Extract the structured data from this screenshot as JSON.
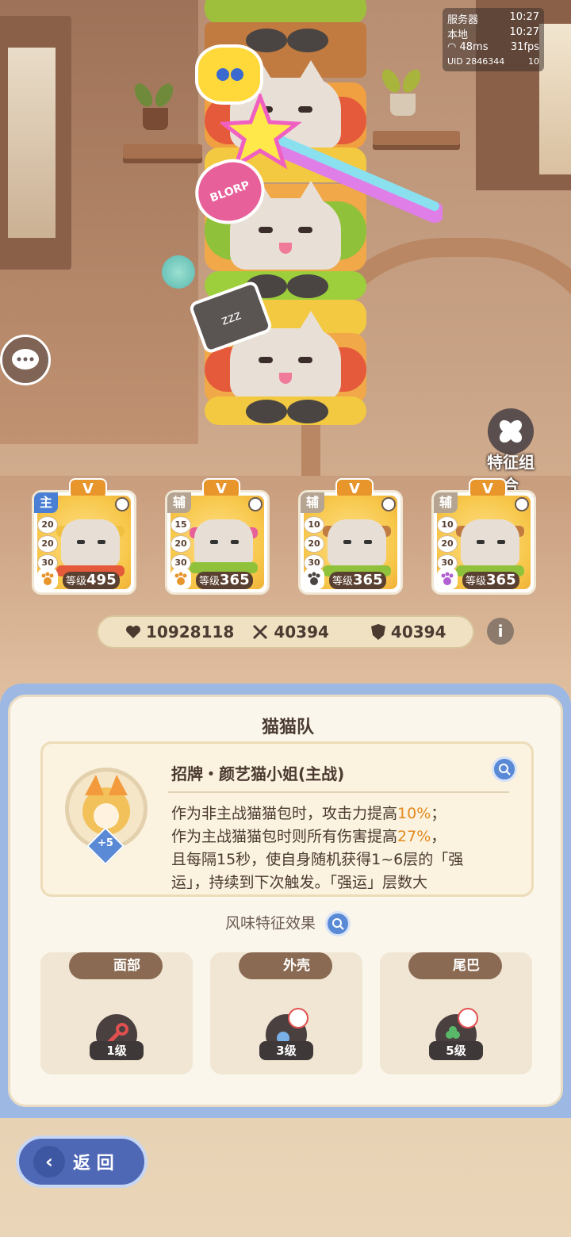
{
  "status": {
    "server_label": "服务器",
    "server_time": "10:27",
    "local_label": "本地",
    "local_time": "10:27",
    "ping": "48ms",
    "fps": "31fps",
    "uid": "UID 2846344",
    "badge": "10"
  },
  "trait_combo_label": "特征组合",
  "cards": [
    {
      "role": "主",
      "vip": "V",
      "nums": [
        "20",
        "20",
        "30"
      ],
      "level_label": "等级",
      "level": "495"
    },
    {
      "role": "辅",
      "vip": "V",
      "nums": [
        "15",
        "20",
        "30"
      ],
      "level_label": "等级",
      "level": "365"
    },
    {
      "role": "辅",
      "vip": "V",
      "nums": [
        "10",
        "20",
        "30"
      ],
      "level_label": "等级",
      "level": "365"
    },
    {
      "role": "辅",
      "vip": "V",
      "nums": [
        "10",
        "20",
        "30"
      ],
      "level_label": "等级",
      "level": "365"
    }
  ],
  "stats": {
    "hp": "10928118",
    "attack": "40394",
    "defense": "40394"
  },
  "panel": {
    "title": "猫猫队",
    "skill_name": "招牌・颜艺猫小姐(主战)",
    "avatar_badge": "+5",
    "desc_lines": [
      {
        "pre": "作为非主战猫猫包时，攻击力提高",
        "hl": "10%",
        "post": "；"
      },
      {
        "pre": "作为主战猫猫包时则所有伤害提高",
        "hl": "27%",
        "post": "，"
      },
      {
        "pre": "且每隔15秒，使自身随机获得1~6层的「强",
        "hl": "",
        "post": ""
      },
      {
        "pre": "运」，持续到下次触发。「强运」层数大",
        "hl": "",
        "post": ""
      }
    ],
    "flavor_title": "风味特征效果",
    "traits": [
      {
        "name": "面部",
        "level": "1级",
        "color": "#f6c15a"
      },
      {
        "name": "外壳",
        "level": "3级",
        "color": "#f2a54a"
      },
      {
        "name": "尾巴",
        "level": "5级",
        "color": "#f39a3c"
      }
    ]
  },
  "back_label": "返 回",
  "sticker_text": "BLORP"
}
